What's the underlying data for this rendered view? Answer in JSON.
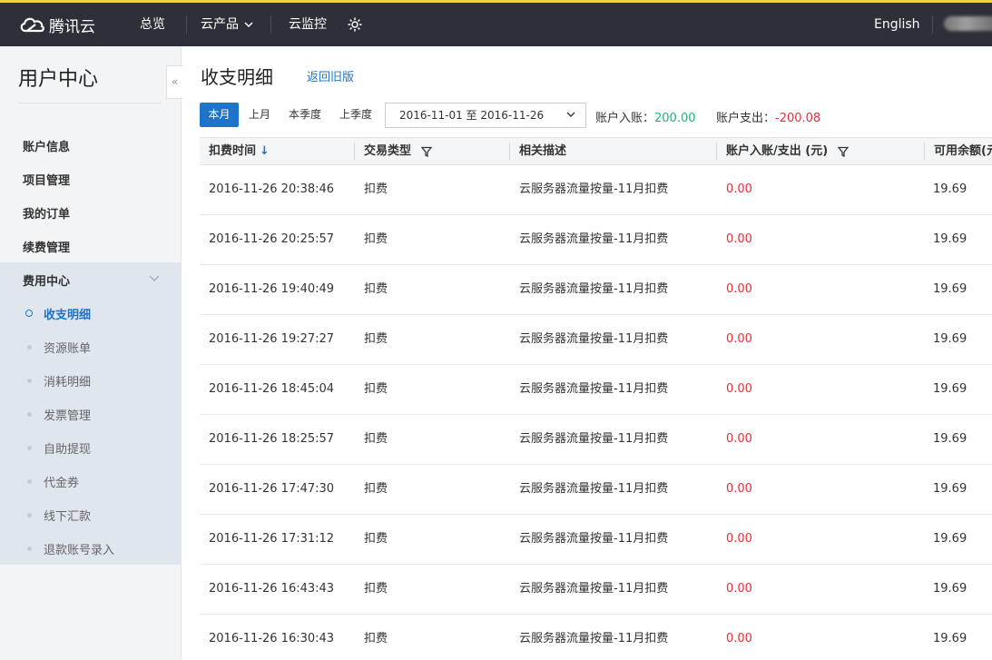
{
  "topbar": {
    "logo_text": "腾讯云",
    "nav": {
      "overview": "总览",
      "products": "云产品",
      "monitor": "云监控"
    },
    "language": "English"
  },
  "sidebar": {
    "title": "用户中心",
    "items": [
      {
        "label": "账户信息"
      },
      {
        "label": "项目管理"
      },
      {
        "label": "我的订单"
      },
      {
        "label": "续费管理"
      }
    ],
    "group": {
      "label": "费用中心",
      "items": [
        {
          "label": "收支明细",
          "active": true
        },
        {
          "label": "资源账单"
        },
        {
          "label": "消耗明细"
        },
        {
          "label": "发票管理"
        },
        {
          "label": "自助提现"
        },
        {
          "label": "代金券"
        },
        {
          "label": "线下汇款"
        },
        {
          "label": "退款账号录入"
        }
      ]
    }
  },
  "main": {
    "title": "收支明细",
    "back_link": "返回旧版",
    "period_buttons": [
      "本月",
      "上月",
      "本季度",
      "上季度"
    ],
    "active_period": "本月",
    "date_range": "2016-11-01 至 2016-11-26",
    "income_label": "账户入账：",
    "income_value": "200.00",
    "expense_label": "账户支出：",
    "expense_value": "-200.08"
  },
  "table": {
    "columns": [
      "扣费时间",
      "交易类型",
      "相关描述",
      "账户入账/支出 (元)",
      "可用余额(元"
    ],
    "sort_arrow": "↓",
    "rows": [
      {
        "time": "2016-11-26 20:38:46",
        "type": "扣费",
        "desc": "云服务器流量按量-11月扣费",
        "amount": "0.00",
        "balance": "19.69"
      },
      {
        "time": "2016-11-26 20:25:57",
        "type": "扣费",
        "desc": "云服务器流量按量-11月扣费",
        "amount": "0.00",
        "balance": "19.69"
      },
      {
        "time": "2016-11-26 19:40:49",
        "type": "扣费",
        "desc": "云服务器流量按量-11月扣费",
        "amount": "0.00",
        "balance": "19.69"
      },
      {
        "time": "2016-11-26 19:27:27",
        "type": "扣费",
        "desc": "云服务器流量按量-11月扣费",
        "amount": "0.00",
        "balance": "19.69"
      },
      {
        "time": "2016-11-26 18:45:04",
        "type": "扣费",
        "desc": "云服务器流量按量-11月扣费",
        "amount": "0.00",
        "balance": "19.69"
      },
      {
        "time": "2016-11-26 18:25:57",
        "type": "扣费",
        "desc": "云服务器流量按量-11月扣费",
        "amount": "0.00",
        "balance": "19.69"
      },
      {
        "time": "2016-11-26 17:47:30",
        "type": "扣费",
        "desc": "云服务器流量按量-11月扣费",
        "amount": "0.00",
        "balance": "19.69"
      },
      {
        "time": "2016-11-26 17:31:12",
        "type": "扣费",
        "desc": "云服务器流量按量-11月扣费",
        "amount": "0.00",
        "balance": "19.69"
      },
      {
        "time": "2016-11-26 16:43:43",
        "type": "扣费",
        "desc": "云服务器流量按量-11月扣费",
        "amount": "0.00",
        "balance": "19.69"
      },
      {
        "time": "2016-11-26 16:30:43",
        "type": "扣费",
        "desc": "云服务器流量按量-11月扣费",
        "amount": "0.00",
        "balance": "19.69"
      }
    ]
  },
  "colors": {
    "topbar_bg": "#2d3038",
    "accent": "#1d74c9",
    "income": "#1cb584",
    "expense": "#e6303a"
  },
  "icons": {
    "logo": "cloud-logo-icon",
    "settings": "gear-icon",
    "collapse": "double-chevron-left-icon",
    "filter": "filter-icon"
  }
}
